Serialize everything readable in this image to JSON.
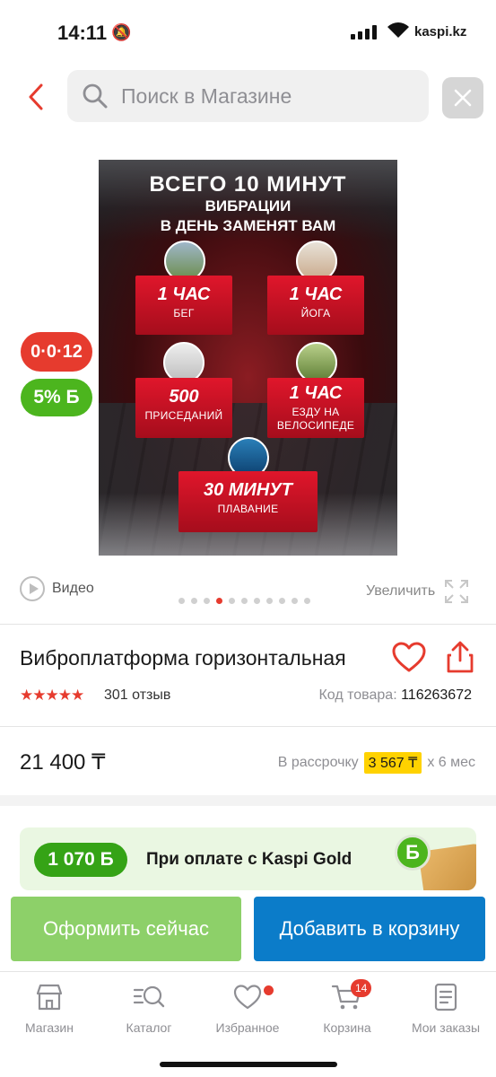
{
  "status_bar": {
    "time": "14:11",
    "carrier_domain": "kaspi.kz"
  },
  "search": {
    "placeholder": "Поиск в Магазине"
  },
  "product_image": {
    "headline": "ВСЕГО 10 МИНУТ",
    "subline1": "ВИБРАЦИИ",
    "subline2": "В ДЕНЬ ЗАМЕНЯТ ВАМ",
    "tiles": [
      {
        "big": "1 ЧАС",
        "small": "БЕГ"
      },
      {
        "big": "1 ЧАС",
        "small": "ЙОГА"
      },
      {
        "big": "500",
        "small": "ПРИСЕДАНИЙ"
      },
      {
        "big": "1 ЧАС",
        "small": "ЕЗДУ НА ВЕЛОСИПЕДЕ"
      },
      {
        "big": "30 МИНУТ",
        "small": "ПЛАВАНИЕ"
      }
    ]
  },
  "badges": {
    "timer": "0·0·12",
    "bonus": "5% Б"
  },
  "media": {
    "video_label": "Видео",
    "zoom_label": "Увеличить",
    "carousel": {
      "total": 11,
      "active_index": 3
    }
  },
  "product": {
    "title": "Виброплатформа горизонтальная",
    "stars": "★★★★★",
    "reviews": "301 отзыв",
    "code_label": "Код товара:",
    "code_value": "116263672"
  },
  "price": {
    "value": "21 400 ₸",
    "installment_label": "В рассрочку",
    "installment_amount": "3 567 ₸",
    "installment_term": "х 6 мес"
  },
  "kaspi_gold": {
    "amount": "1 070 Б",
    "text": "При оплате с Kaspi Gold",
    "coin": "Б"
  },
  "actions": {
    "buy_now": "Оформить сейчас",
    "add_to_cart": "Добавить в корзину"
  },
  "tabbar": {
    "items": [
      {
        "label": "Магазин"
      },
      {
        "label": "Каталог"
      },
      {
        "label": "Избранное"
      },
      {
        "label": "Корзина",
        "badge": "14"
      },
      {
        "label": "Мои заказы"
      }
    ]
  },
  "colors": {
    "accent_red": "#e63b2e",
    "kaspi_green": "#4cb51e",
    "cart_blue": "#0b7cc9",
    "buy_green": "#8dd069",
    "highlight_yellow": "#ffd200"
  }
}
